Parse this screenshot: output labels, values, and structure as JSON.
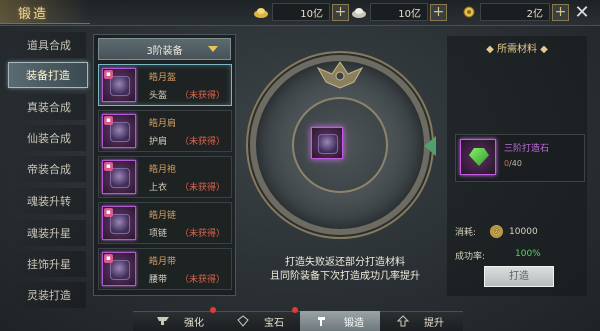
{
  "header": {
    "title": "锻造",
    "resources": [
      {
        "icon": "gold-ingot-icon",
        "value": "10亿"
      },
      {
        "icon": "silver-ingot-icon",
        "value": "10亿"
      },
      {
        "icon": "coin-icon",
        "value": "2亿"
      }
    ],
    "close_icon": "close-icon"
  },
  "sidebar": {
    "items": [
      {
        "label": "道具合成",
        "active": false
      },
      {
        "label": "装备打造",
        "active": true
      },
      {
        "label": "真装合成",
        "active": false
      },
      {
        "label": "仙装合成",
        "active": false
      },
      {
        "label": "帝装合成",
        "active": false
      },
      {
        "label": "魂装升转",
        "active": false
      },
      {
        "label": "魂装升星",
        "active": false
      },
      {
        "label": "挂饰升星",
        "active": false
      },
      {
        "label": "灵装打造",
        "active": false
      }
    ]
  },
  "equipment_list": {
    "dropdown_value": "3阶装备",
    "items": [
      {
        "name": "皓月盔",
        "type": "头盔",
        "status": "（未获得）",
        "selected": true
      },
      {
        "name": "皓月肩",
        "type": "护肩",
        "status": "（未获得）",
        "selected": false
      },
      {
        "name": "皓月袍",
        "type": "上衣",
        "status": "（未获得）",
        "selected": false
      },
      {
        "name": "皓月链",
        "type": "项链",
        "status": "（未获得）",
        "selected": false
      },
      {
        "name": "皓月带",
        "type": "腰带",
        "status": "（未获得）",
        "selected": false
      }
    ]
  },
  "forge": {
    "hint_line1": "打造失败返还部分打造材料",
    "hint_line2": "且同阶装备下次打造成功几率提升"
  },
  "materials": {
    "header": "所需材料",
    "item": {
      "name": "三阶打造石",
      "owned": "0",
      "required": "/40"
    },
    "cost_label": "消耗:",
    "cost_value": "10000",
    "rate_label": "成功率:",
    "rate_value": "100%",
    "forge_button": "打造"
  },
  "bottom_tabs": [
    {
      "label": "强化",
      "icon": "anvil-icon",
      "active": false,
      "dot": true
    },
    {
      "label": "宝石",
      "icon": "gem-icon",
      "active": false,
      "dot": false
    },
    {
      "label": "锻造",
      "icon": "hammer-icon",
      "active": true,
      "dot": true
    },
    {
      "label": "提升",
      "icon": "upgrade-icon",
      "active": false,
      "dot": false
    }
  ],
  "colors": {
    "accent_gold": "#e9c45a",
    "not_obtained": "#e0644a",
    "success_rate": "#5fd06a",
    "material_name": "#c46be0"
  }
}
